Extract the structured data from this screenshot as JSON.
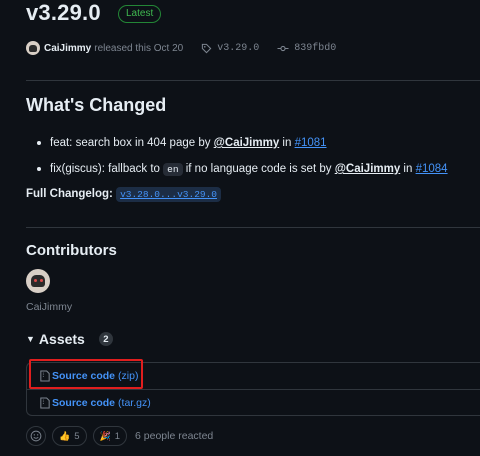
{
  "release": {
    "title": "v3.29.0",
    "badge": "Latest",
    "author": "CaiJimmy",
    "released_text": "released this Oct 20",
    "tag": "v3.29.0",
    "commit": "839fbd0"
  },
  "changes": {
    "heading": "What's Changed",
    "items": [
      {
        "prefix": "feat: search box in 404 page by ",
        "mention": "@CaiJimmy",
        "mid": " in ",
        "issue": "#1081"
      },
      {
        "prefix": "fix(giscus): fallback to ",
        "code": "en",
        "prefix2": " if no language code is set by ",
        "mention": "@CaiJimmy",
        "mid": " in ",
        "issue": "#1084"
      }
    ],
    "changelog_label": "Full Changelog: ",
    "changelog_link": "v3.28.0...v3.29.0"
  },
  "contributors": {
    "heading": "Contributors",
    "names": [
      "CaiJimmy"
    ]
  },
  "assets": {
    "heading": "Assets",
    "count": "2",
    "items": [
      {
        "name": "Source code",
        "ext": "(zip)"
      },
      {
        "name": "Source code",
        "ext": "(tar.gz)"
      }
    ]
  },
  "reactions": {
    "thumbs_up_count": "5",
    "party_count": "1",
    "summary": "6 people reacted"
  },
  "colors": {
    "background": "#0d1117",
    "link": "#4493f8",
    "latest_green": "#3fb950",
    "highlight_red": "#e01e1e"
  }
}
